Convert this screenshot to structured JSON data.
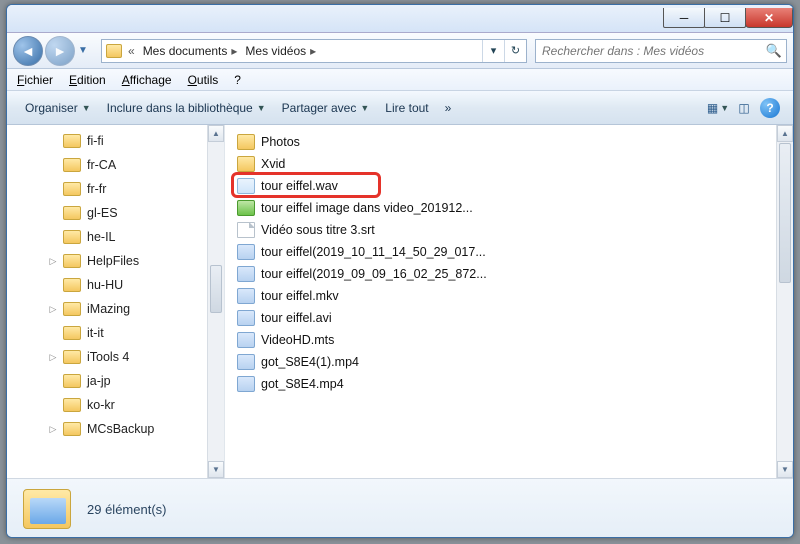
{
  "window": {
    "breadcrumb_chevrons": "«",
    "breadcrumb": [
      "Mes documents",
      "Mes vidéos"
    ],
    "search_placeholder": "Rechercher dans : Mes vidéos"
  },
  "menu": {
    "fichier": "Fichier",
    "edition": "Edition",
    "affichage": "Affichage",
    "outils": "Outils",
    "help": "?"
  },
  "toolbar": {
    "organiser": "Organiser",
    "inclure": "Inclure dans la bibliothèque",
    "partager": "Partager avec",
    "lire": "Lire tout",
    "overflow": "»"
  },
  "tree": [
    {
      "label": "fi-fi",
      "exp": false
    },
    {
      "label": "fr-CA",
      "exp": false
    },
    {
      "label": "fr-fr",
      "exp": false
    },
    {
      "label": "gl-ES",
      "exp": false
    },
    {
      "label": "he-IL",
      "exp": false
    },
    {
      "label": "HelpFiles",
      "exp": true
    },
    {
      "label": "hu-HU",
      "exp": false
    },
    {
      "label": "iMazing",
      "exp": true
    },
    {
      "label": "it-it",
      "exp": false
    },
    {
      "label": "iTools 4",
      "exp": true
    },
    {
      "label": "ja-jp",
      "exp": false
    },
    {
      "label": "ko-kr",
      "exp": false
    },
    {
      "label": "MCsBackup",
      "exp": true
    }
  ],
  "files": [
    {
      "name": "Photos",
      "type": "folder"
    },
    {
      "name": "Xvid",
      "type": "folder"
    },
    {
      "name": "tour eiffel.wav",
      "type": "wav",
      "highlighted": true
    },
    {
      "name": "tour eiffel image dans video_201912...",
      "type": "img"
    },
    {
      "name": "Vidéo sous titre 3.srt",
      "type": "file"
    },
    {
      "name": "tour eiffel(2019_10_11_14_50_29_017...",
      "type": "vid"
    },
    {
      "name": "tour eiffel(2019_09_09_16_02_25_872...",
      "type": "vid"
    },
    {
      "name": "tour eiffel.mkv",
      "type": "vid"
    },
    {
      "name": "tour eiffel.avi",
      "type": "vid"
    },
    {
      "name": "VideoHD.mts",
      "type": "vid"
    },
    {
      "name": "got_S8E4(1).mp4",
      "type": "vid"
    },
    {
      "name": "got_S8E4.mp4",
      "type": "vid"
    }
  ],
  "status": {
    "count_text": "29 élément(s)"
  }
}
